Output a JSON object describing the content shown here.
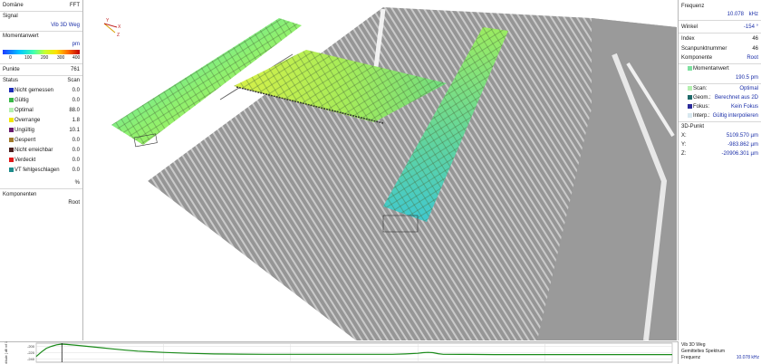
{
  "left": {
    "domain_label": "Domäne",
    "domain_value": "FFT",
    "signal_label": "Signal",
    "signal_value": "Vib 3D Weg",
    "moment_label": "Momentanwert",
    "unit": "pm",
    "scale_ticks": [
      "0",
      "100",
      "200",
      "300",
      "400"
    ],
    "points_label": "Punkte",
    "points_value": "761",
    "status_label": "Status",
    "status_value": "Scan",
    "status_items": [
      {
        "label": "Nicht gemessen",
        "value": "0.0",
        "color": "#1f2fb8"
      },
      {
        "label": "Gültig",
        "value": "0.0",
        "color": "#3ab848"
      },
      {
        "label": "Optimal",
        "value": "88.0",
        "color": "#b4f0b0"
      },
      {
        "label": "Overrange",
        "value": "1.8",
        "color": "#f2e600"
      },
      {
        "label": "Ungültig",
        "value": "10.1",
        "color": "#6a1c6e"
      },
      {
        "label": "Gesperrt",
        "value": "0.0",
        "color": "#a07a2a"
      },
      {
        "label": "Nicht erreichbar",
        "value": "0.0",
        "color": "#4a2020"
      },
      {
        "label": "Verdeckt",
        "value": "0.0",
        "color": "#e01818"
      },
      {
        "label": "VT fehlgeschlagen",
        "value": "0.0",
        "color": "#1f8c8c"
      }
    ],
    "percent_symbol": "%",
    "components_label": "Komponenten",
    "components_value": "Root"
  },
  "right": {
    "freq_label": "Frequenz",
    "freq_value": "10.078",
    "freq_unit": "kHz",
    "angle_label": "Winkel",
    "angle_value": "-154 °",
    "index_label": "Index",
    "index_value": "46",
    "scanpoint_label": "Scanpunktnummer",
    "scanpoint_value": "46",
    "component_label": "Komponente",
    "component_value": "Root",
    "moment_label": "Momentanwert",
    "moment_value": "190.5 pm",
    "scan_label": "Scan:",
    "scan_value": "Optimal",
    "geom_label": "Geom.:",
    "geom_value": "Berechnet aus 2D",
    "focus_label": "Fokus:",
    "focus_value": "Kein Fokus",
    "interp_label": "Interp.:",
    "interp_value": "Gültig interpolieren",
    "point3d_label": "3D-Punkt",
    "x_label": "X:",
    "x_value": "5109.570 µm",
    "y_label": "Y:",
    "y_value": "-983.862 µm",
    "z_label": "Z:",
    "z_value": "-20906.301 µm",
    "colors": {
      "moment": "#7ee0a0",
      "scan": "#b4f0b0",
      "geom": "#1f6a6a",
      "focus": "#2b2b9a",
      "interp": "#d8e8f0"
    }
  },
  "axes3d": {
    "x": "X",
    "y": "Y",
    "z": "Z"
  },
  "bottom": {
    "signal_value": "Vib 3D Weg",
    "avg_label": "Gemitteltes Spektrum",
    "freq_label": "Frequenz",
    "freq_value": "10.078 kHz",
    "amp_label": "Amplitude",
    "amp_value": "-190.60 dB",
    "amp_color": "#1a8a1a"
  },
  "chart_data": {
    "type": "line",
    "title": "",
    "xlabel": "Frequenz [ kHz ]",
    "ylabel": "Amplitude [ dB ref 1 m ]",
    "xlim": [
      0,
      250
    ],
    "ylim": [
      -250,
      -190
    ],
    "x_ticks": [
      "0",
      "50",
      "100",
      "150",
      "200",
      "250"
    ],
    "y_ticks": [
      "-200",
      "-220",
      "-240"
    ],
    "cursor_x": 10.078,
    "series": [
      {
        "color": "#1a8a1a",
        "x": [
          0,
          2,
          4,
          6,
          8,
          10,
          12,
          15,
          20,
          25,
          30,
          35,
          40,
          50,
          60,
          70,
          80,
          90,
          100,
          110,
          120,
          130,
          140,
          145,
          150,
          152,
          154,
          156,
          158,
          160,
          170,
          180,
          200,
          220,
          250
        ],
        "y": [
          -232,
          -218,
          -206,
          -200,
          -195,
          -193,
          -194,
          -196,
          -200,
          -204,
          -208,
          -212,
          -215,
          -219,
          -222,
          -224,
          -224.5,
          -225,
          -225,
          -225,
          -225,
          -225,
          -225,
          -224,
          -222,
          -220,
          -219,
          -220,
          -223,
          -225,
          -225.5,
          -226,
          -226,
          -226,
          -226
        ]
      }
    ]
  }
}
